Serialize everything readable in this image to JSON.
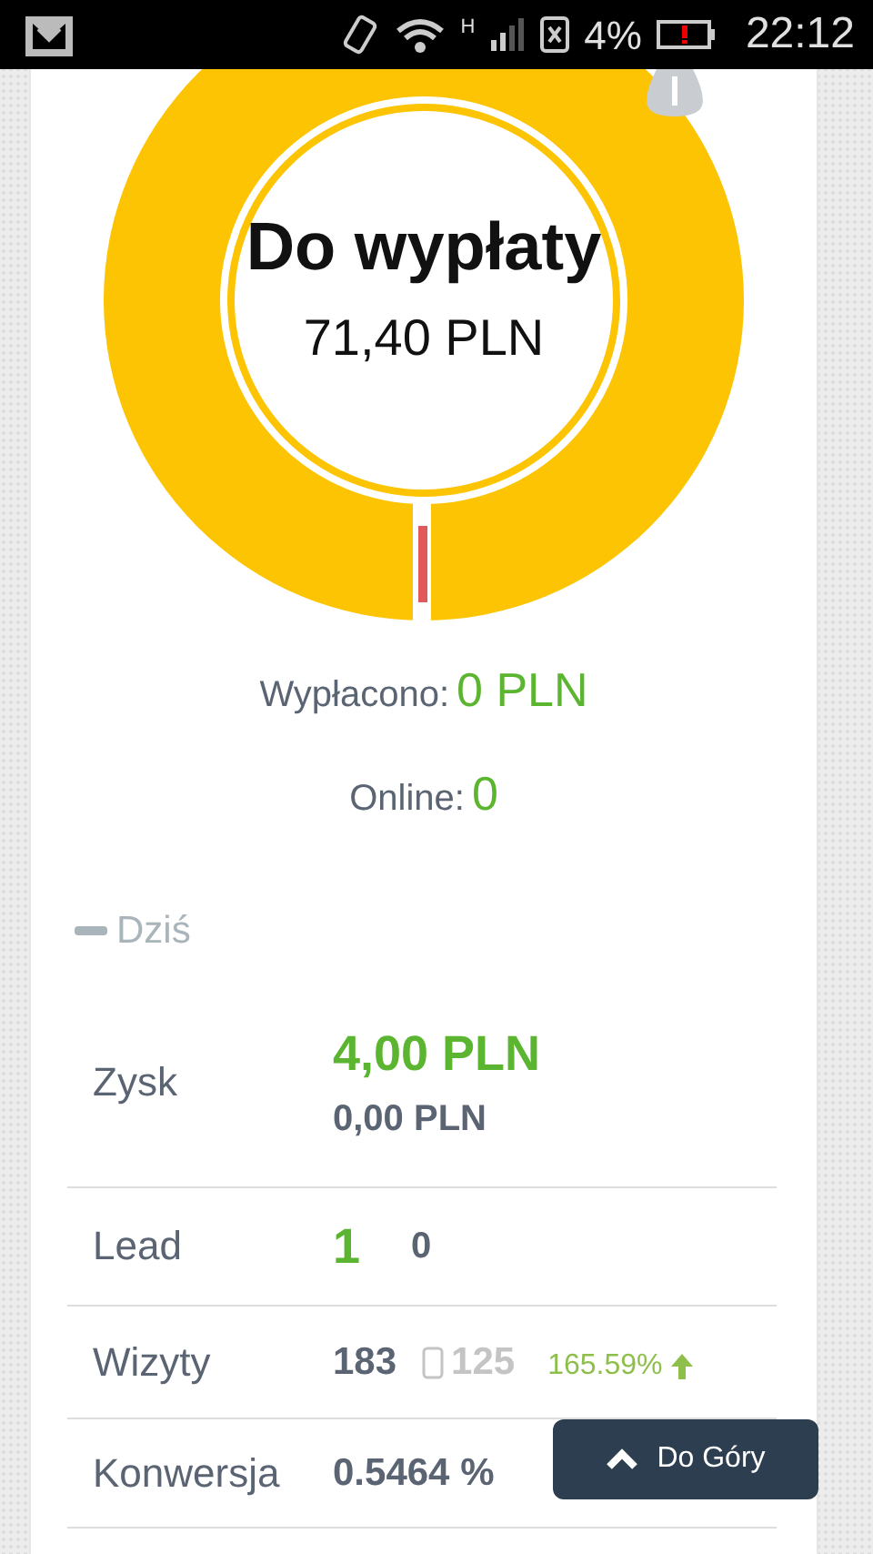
{
  "status_bar": {
    "network_type": "H",
    "battery": "4%",
    "time": "22:12"
  },
  "balance": {
    "title": "Do wypłaty",
    "amount": "71,40 PLN"
  },
  "paid": {
    "label": "Wypłacono:",
    "value": "0 PLN"
  },
  "online": {
    "label": "Online:",
    "value": "0"
  },
  "section": {
    "title": "Dziś",
    "expanded": true
  },
  "stats": [
    {
      "label": "Zysk",
      "kind": "highlight",
      "value": "4,00 PLN",
      "secondary": "0,00 PLN"
    },
    {
      "label": "Lead",
      "kind": "highlight",
      "value": "1",
      "secondary": "0"
    },
    {
      "label": "Wizyty",
      "kind": "plain",
      "value": "183",
      "mobile": "125",
      "change": "165.59%",
      "rising": true
    },
    {
      "label": "Konwersja",
      "kind": "plain",
      "value": "0.5464 %"
    }
  ],
  "scroll_top_button": {
    "label": "Do Góry"
  }
}
